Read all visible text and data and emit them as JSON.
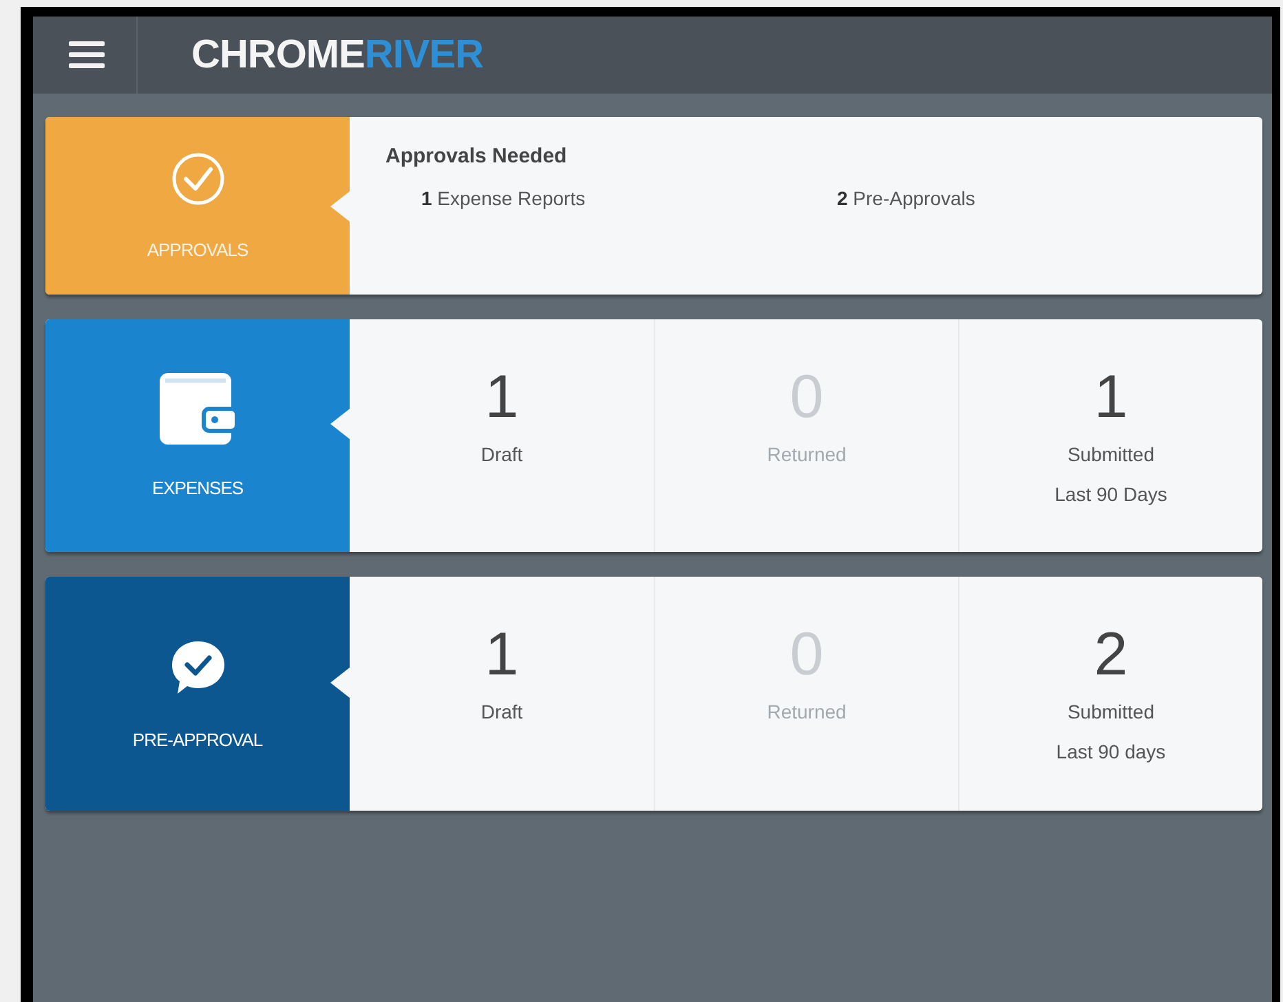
{
  "header": {
    "logo_first": "CHROME",
    "logo_second": "RIVER"
  },
  "tiles": [
    {
      "kind": "approvals",
      "label": "APPROVALS",
      "color": "#f0a843",
      "heading": "Approvals Needed",
      "items": [
        "**1** Expense Reports",
        "**2** Pre-Approvals"
      ]
    },
    {
      "kind": "expenses",
      "label": "EXPENSES",
      "color": "#1a84cf",
      "stats": [
        {
          "value": "1",
          "label": "Draft",
          "dimmed": false
        },
        {
          "value": "0",
          "label": "Returned",
          "dimmed": true
        },
        {
          "value": "1",
          "label": "Submitted",
          "sublabel": "Last 90 Days",
          "dimmed": false
        }
      ]
    },
    {
      "kind": "pre_approval",
      "label": "PRE-APPROVAL",
      "color": "#0d5791",
      "stats": [
        {
          "value": "1",
          "label": "Draft",
          "dimmed": false
        },
        {
          "value": "0",
          "label": "Returned",
          "dimmed": true
        },
        {
          "value": "2",
          "label": "Submitted",
          "sublabel": "Last 90 days",
          "dimmed": false
        }
      ]
    }
  ]
}
